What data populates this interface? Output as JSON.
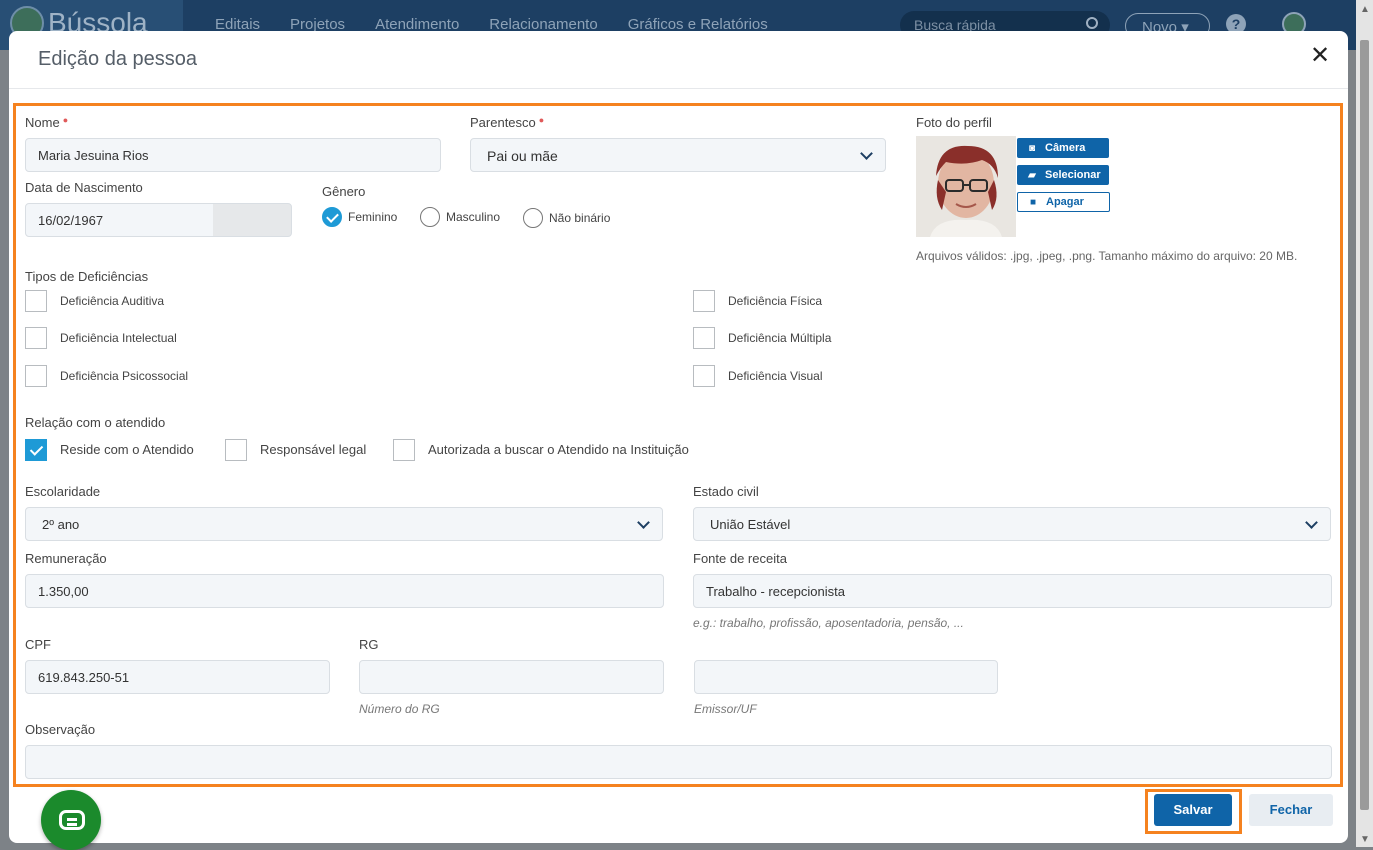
{
  "nav": {
    "logo": "Bússola",
    "items": [
      "Editais",
      "Projetos",
      "Atendimento",
      "Relacionamento",
      "Gráficos e Relatórios"
    ],
    "search_placeholder": "Busca rápida",
    "new_label": "Novo",
    "help_label": "?"
  },
  "modal": {
    "title": "Edição da pessoa",
    "close_label": "✕"
  },
  "form": {
    "nome": {
      "label": "Nome",
      "value": "Maria Jesuina Rios"
    },
    "parentesco": {
      "label": "Parentesco",
      "value": "Pai ou mãe"
    },
    "foto": {
      "label": "Foto do perfil",
      "camera": "Câmera",
      "selecionar": "Selecionar",
      "apagar": "Apagar",
      "hint": "Arquivos válidos: .jpg, .jpeg, .png. Tamanho máximo do arquivo: 20 MB."
    },
    "nascimento": {
      "label": "Data de Nascimento",
      "value": "16/02/1967"
    },
    "genero": {
      "label": "Gênero",
      "options": [
        "Feminino",
        "Masculino",
        "Não binário"
      ],
      "selected": "Feminino"
    },
    "deficiencias": {
      "label": "Tipos de Deficiências",
      "items": [
        "Deficiência Auditiva",
        "Deficiência Física",
        "Deficiência Intelectual",
        "Deficiência Múltipla",
        "Deficiência Psicossocial",
        "Deficiência Visual"
      ]
    },
    "relacao": {
      "label": "Relação com o atendido",
      "items": [
        "Reside com o Atendido",
        "Responsável legal",
        "Autorizada a buscar o Atendido na Instituição"
      ],
      "checked": "Reside com o Atendido"
    },
    "escolaridade": {
      "label": "Escolaridade",
      "value": "2º ano"
    },
    "estado_civil": {
      "label": "Estado civil",
      "value": "União Estável"
    },
    "remuneracao": {
      "label": "Remuneração",
      "value": "1.350,00"
    },
    "fonte_receita": {
      "label": "Fonte de receita",
      "value": "Trabalho - recepcionista",
      "hint": "e.g.: trabalho, profissão, aposentadoria, pensão, ..."
    },
    "cpf": {
      "label": "CPF",
      "value": "619.843.250-51"
    },
    "rg": {
      "label": "RG",
      "value": "",
      "hint": "Número do RG"
    },
    "emissor": {
      "value": "",
      "hint": "Emissor/UF"
    },
    "observacao": {
      "label": "Observação",
      "value": ""
    }
  },
  "footer": {
    "save": "Salvar",
    "close": "Fechar"
  },
  "colors": {
    "accent": "#0f64a8",
    "highlight": "#f5821f",
    "check": "#1e9ad6"
  }
}
